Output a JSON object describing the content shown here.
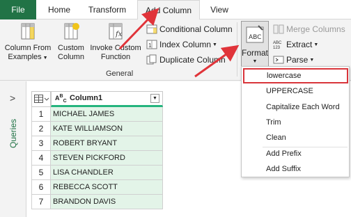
{
  "tabs": {
    "file": "File",
    "home": "Home",
    "transform": "Transform",
    "add_column": "Add Column",
    "view": "View"
  },
  "ribbon": {
    "column_from_examples": [
      "Column From",
      "Examples"
    ],
    "custom_column": [
      "Custom",
      "Column"
    ],
    "invoke_custom_function": [
      "Invoke Custom",
      "Function"
    ],
    "conditional_column": "Conditional Column",
    "index_column": "Index Column",
    "duplicate_column": "Duplicate Column",
    "group_general": "General",
    "format": "Format",
    "merge_columns": "Merge Columns",
    "extract": "Extract",
    "parse": "Parse",
    "format_icon_text": "ABC",
    "extract_icon_text": "ABC\n123"
  },
  "queries_pane": {
    "label": "Queries",
    "collapse_glyph": ">"
  },
  "grid": {
    "column_type": "ABC",
    "column_header": "Column1",
    "rows": [
      {
        "n": "1",
        "v": "MICHAEL JAMES"
      },
      {
        "n": "2",
        "v": "KATE WILLIAMSON"
      },
      {
        "n": "3",
        "v": "ROBERT BRYANT"
      },
      {
        "n": "4",
        "v": "STEVEN PICKFORD"
      },
      {
        "n": "5",
        "v": "LISA CHANDLER"
      },
      {
        "n": "6",
        "v": "REBECCA SCOTT"
      },
      {
        "n": "7",
        "v": "BRANDON DAVIS"
      }
    ]
  },
  "format_menu": {
    "items": [
      "lowercase",
      "UPPERCASE",
      "Capitalize Each Word",
      "Trim",
      "Clean",
      "Add Prefix",
      "Add Suffix"
    ],
    "highlighted": "lowercase"
  },
  "colors": {
    "accent_green": "#217346",
    "highlight_red": "#d9343a",
    "column_bar": "#25b47e"
  }
}
